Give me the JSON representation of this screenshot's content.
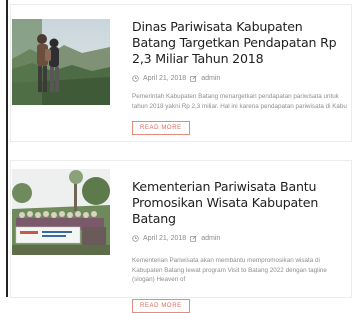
{
  "posts": [
    {
      "title": "Dinas Pariwisata Kabupaten Batang Targetkan Pendapatan Rp 2,3 Miliar Tahun 2018",
      "date": "April 21, 2018",
      "author": "admin",
      "excerpt": "Pemerintah Kabupaten Batang menargetkan pendapatan pariwisata untuk tahun 2018 yakni Rp 2,3 miliar. Hal ini karena pendapatan pariwisata di Kabu",
      "read_more": "READ MORE",
      "image_icon": "photo-hikers-mountain"
    },
    {
      "title": "Kementerian Pariwisata Bantu Promosikan Wisata Kabupaten Batang",
      "date": "April 21, 2018",
      "author": "admin",
      "excerpt": "Kementerian Pariwisata akan membantu mempromosikan wisata di Kabupaten Batang lewat program Visit to Batang 2022 dengan tagline (slogan) Heaven of",
      "read_more": "READ MORE",
      "image_icon": "photo-group-banner"
    }
  ],
  "colors": {
    "accent": "#d96c5c",
    "title": "#1f1f1f",
    "muted": "#8e8e8e"
  }
}
